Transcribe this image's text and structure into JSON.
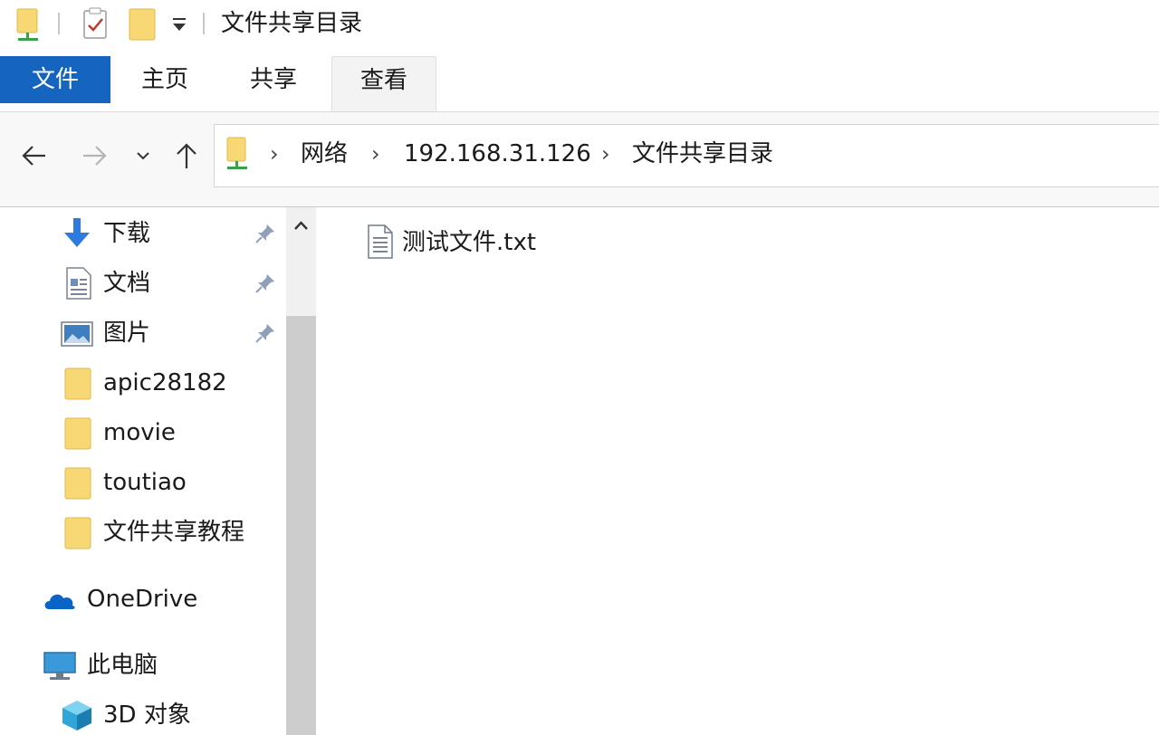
{
  "window": {
    "title": "文件共享目录"
  },
  "ribbon": {
    "tabs": [
      {
        "label": "文件",
        "active": true
      },
      {
        "label": "主页"
      },
      {
        "label": "共享"
      },
      {
        "label": "查看",
        "selected": true
      }
    ]
  },
  "address_bar": {
    "path": [
      "网络",
      "192.168.31.126",
      "文件共享目录"
    ],
    "separator": "›"
  },
  "sidebar": {
    "quick_access": [
      {
        "label": "下载",
        "icon": "download-icon",
        "pinned": true
      },
      {
        "label": "文档",
        "icon": "document-icon",
        "pinned": true
      },
      {
        "label": "图片",
        "icon": "picture-icon",
        "pinned": true
      },
      {
        "label": "apic28182",
        "icon": "folder-icon"
      },
      {
        "label": "movie",
        "icon": "folder-icon"
      },
      {
        "label": "toutiao",
        "icon": "folder-icon"
      },
      {
        "label": "文件共享教程",
        "icon": "folder-icon"
      }
    ],
    "onedrive": {
      "label": "OneDrive",
      "icon": "cloud-icon"
    },
    "this_pc": {
      "label": "此电脑",
      "icon": "computer-icon"
    },
    "objects_3d": {
      "label": "3D 对象",
      "icon": "cube-icon"
    }
  },
  "files": [
    {
      "name": "测试文件.txt",
      "icon": "text-file-icon"
    }
  ],
  "colors": {
    "accent": "#1565c0",
    "folder": "#f8d775",
    "folder_edge": "#e0b84a"
  }
}
